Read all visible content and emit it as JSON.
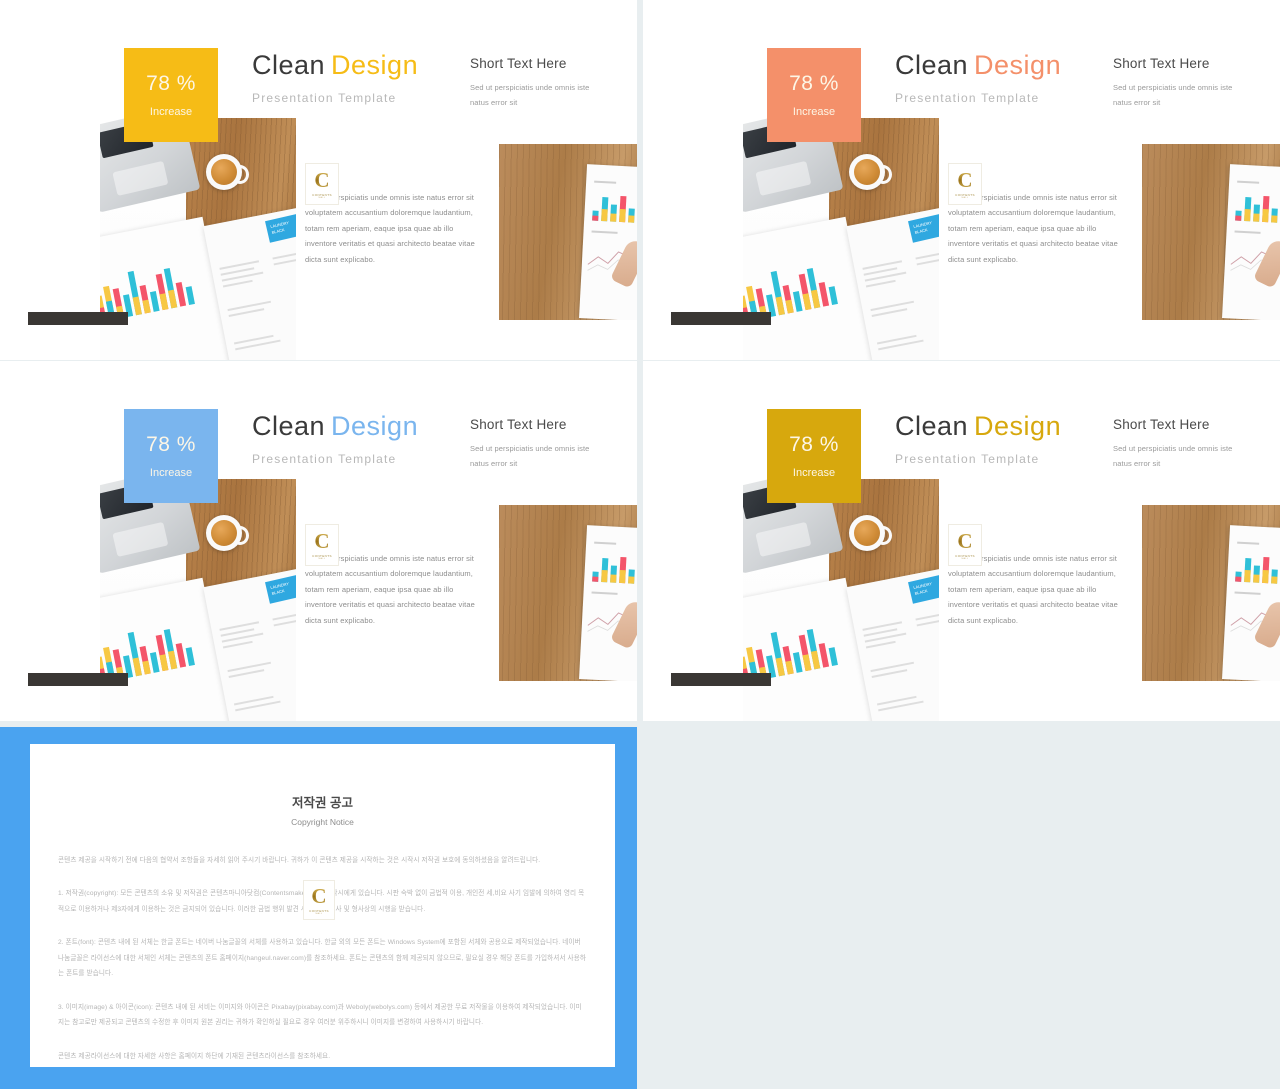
{
  "page": {
    "background_color": "#e8eef0"
  },
  "slides": [
    {
      "id": "slide-yellow",
      "accent_color": "#f6bc16",
      "badge": {
        "percent": "78 %",
        "label": "Increase"
      },
      "title_primary": "Clean",
      "title_accent": "Design",
      "subtitle": "Presentation  Template",
      "right_heading": "Short Text Here",
      "right_body": "Sed ut perspiciatis  unde  omnis  iste natus error sit",
      "body": "Sed ut perspiciatis  unde omnis iste natus error sit voluptatem  accusantium doloremque  laudantium,  totam rem aperiam,  eaque ipsa quae ab illo inventore  veritatis et quasi architecto beatae vitae dicta sunt explicabo."
    },
    {
      "id": "slide-orange",
      "accent_color": "#f4906a",
      "badge": {
        "percent": "78 %",
        "label": "Increase"
      },
      "title_primary": "Clean",
      "title_accent": "Design",
      "subtitle": "Presentation  Template",
      "right_heading": "Short Text Here",
      "right_body": "Sed ut perspiciatis  unde  omnis  iste natus error sit",
      "body": "Sed ut perspiciatis  unde omnis iste natus error sit voluptatem  accusantium doloremque  laudantium,  totam rem aperiam,  eaque ipsa quae ab illo inventore  veritatis et quasi architecto beatae vitae dicta sunt explicabo."
    },
    {
      "id": "slide-blue",
      "accent_color": "#7ab5ee",
      "badge": {
        "percent": "78 %",
        "label": "Increase"
      },
      "title_primary": "Clean",
      "title_accent": "Design",
      "subtitle": "Presentation  Template",
      "right_heading": "Short Text Here",
      "right_body": "Sed ut perspiciatis  unde  omnis  iste natus error sit",
      "body": "Sed ut perspiciatis  unde omnis iste natus error sit voluptatem  accusantium doloremque  laudantium,  totam rem aperiam,  eaque ipsa quae ab illo inventore  veritatis et quasi architecto beatae vitae dicta sunt explicabo."
    },
    {
      "id": "slide-gold",
      "accent_color": "#d7a80d",
      "badge": {
        "percent": "78 %",
        "label": "Increase"
      },
      "title_primary": "Clean",
      "title_accent": "Design",
      "subtitle": "Presentation  Template",
      "right_heading": "Short Text Here",
      "right_body": "Sed ut perspiciatis  unde  omnis  iste natus error sit",
      "body": "Sed ut perspiciatis  unde omnis iste natus error sit voluptatem  accusantium doloremque  laudantium,  totam rem aperiam,  eaque ipsa quae ab illo inventore  veritatis et quasi architecto beatae vitae dicta sunt explicabo."
    }
  ],
  "watermark": {
    "letter": "C",
    "name": "CONTENTS",
    "sub": "MALL"
  },
  "copyright_slide": {
    "frame_color": "#4aa3f0",
    "heading_ko": "저작권 공고",
    "heading_en": "Copyright Notice",
    "intro": "콘텐츠 제공을 시작하기 전에 다음의 협약서 조항들을 자세히 읽어 주시기 바랍니다. 귀하가 이 콘텐츠 제공을 시작하는 것은 시작시 저작권 보호에 동의하셨음을 알려드립니다.",
    "item1": "1. 저작권(copyright): 모든 콘텐츠의 소유 및 저작권은 콘텐츠마니아닷컴(Contentsmakeout)사 제작시에게 있습니다. 시판 숙박 없이 금법적 이용, 개인전 세,비요 사기 임발에 의하여 영리 목적으로 이용하거나 제3자에게 이용하는 것은 금지되어 있습니다. 이러한 금법 행위 발견 시 준인된 민사 및 형사상의 시행을 받습니다.",
    "item2": "2. 폰트(font): 콘텐츠 내에 된 서체는 한글 폰트는 네이버 나눔글꼴의 서체를 사용하고 있습니다. 한글 외의 모든 폰트는 Windows System에 포함된 서체와 공용으로 제작되었습니다. 네이버 나눔글꼴은 라이선스에 대한 서체인 서체는 콘텐츠의 폰트 홈페이지(hangeul.naver.com)를 참조하세요. 폰트는 콘텐츠의 함께 제공되지 않으므로, 필요실 경우 해당 폰트를 가입하셔서 사용하는 폰트를 받습니다.",
    "item3": "3. 이미지(image) & 아이콘(icon): 콘텐츠 내에 된 서비는 이미지와 아이콘은 Pixabay(pixabay.com)과 Weboly(webolys.com) 등에서 제공한 무료 저작물을 이용하여 제작되었습니다. 이미지는 참고로만 제공되고 콘텐츠의 수정한 후 이미지 원본 권리는 귀하가 확인하실 필요로 경우 여러분 위주하시니 이미지를 변경하여 사용하시기 바랍니다.",
    "footer": "콘텐츠 제공라이선스에 대한 자세한 사항은 홈페이지 하단에 기재된 콘텐츠라이선스를 참조하세요."
  },
  "photo": {
    "left_alt": "desk-with-laptop-coffee-and-charts",
    "right_alt": "wood-desk-with-hand-pointing-at-chart-paper",
    "chart_bar_colors": [
      "#2fc0d8",
      "#f4556a",
      "#f7c843"
    ]
  }
}
